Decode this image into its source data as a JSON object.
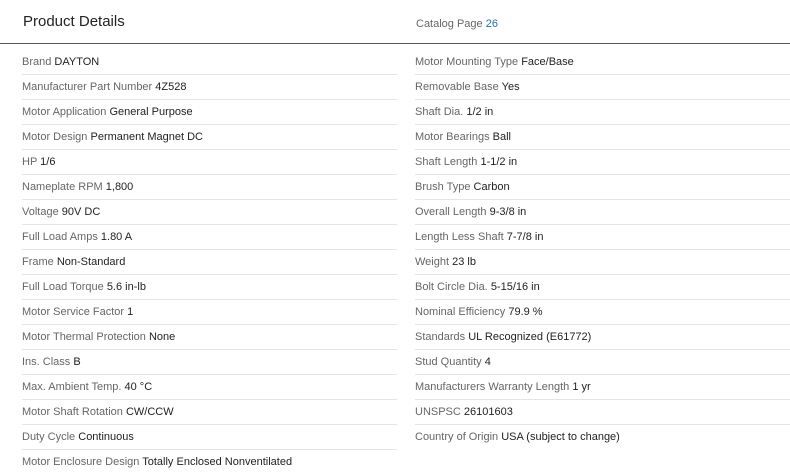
{
  "header": {
    "title": "Product Details",
    "catalog_label": "Catalog Page",
    "catalog_value": "26"
  },
  "left": [
    {
      "label": "Brand",
      "value": "DAYTON"
    },
    {
      "label": "Manufacturer Part Number",
      "value": "4Z528"
    },
    {
      "label": "Motor Application",
      "value": "General Purpose"
    },
    {
      "label": "Motor Design",
      "value": "Permanent Magnet DC"
    },
    {
      "label": "HP",
      "value": "1/6"
    },
    {
      "label": "Nameplate RPM",
      "value": "1,800"
    },
    {
      "label": "Voltage",
      "value": "90V DC"
    },
    {
      "label": "Full Load Amps",
      "value": "1.80 A"
    },
    {
      "label": "Frame",
      "value": "Non-Standard"
    },
    {
      "label": "Full Load Torque",
      "value": "5.6 in-lb"
    },
    {
      "label": "Motor Service Factor",
      "value": "1"
    },
    {
      "label": "Motor Thermal Protection",
      "value": "None"
    },
    {
      "label": "Ins. Class",
      "value": "B"
    },
    {
      "label": "Max. Ambient Temp.",
      "value": "40 °C"
    },
    {
      "label": "Motor Shaft Rotation",
      "value": "CW/CCW"
    },
    {
      "label": "Duty Cycle",
      "value": "Continuous"
    },
    {
      "label": "Motor Enclosure Design",
      "value": "Totally Enclosed Nonventilated"
    }
  ],
  "right": [
    {
      "label": "Motor Mounting Type",
      "value": "Face/Base"
    },
    {
      "label": "Removable Base",
      "value": "Yes"
    },
    {
      "label": "Shaft Dia.",
      "value": "1/2 in"
    },
    {
      "label": "Motor Bearings",
      "value": "Ball"
    },
    {
      "label": "Shaft Length",
      "value": "1-1/2 in"
    },
    {
      "label": "Brush Type",
      "value": "Carbon"
    },
    {
      "label": "Overall Length",
      "value": "9-3/8 in"
    },
    {
      "label": "Length Less Shaft",
      "value": "7-7/8 in"
    },
    {
      "label": "Weight",
      "value": "23 lb"
    },
    {
      "label": "Bolt Circle Dia.",
      "value": "5-15/16 in"
    },
    {
      "label": "Nominal Efficiency",
      "value": "79.9 %"
    },
    {
      "label": "Standards",
      "value": "UL Recognized (E61772)"
    },
    {
      "label": "Stud Quantity",
      "value": "4"
    },
    {
      "label": "Manufacturers Warranty Length",
      "value": "1 yr"
    },
    {
      "label": "UNSPSC",
      "value": "26101603"
    },
    {
      "label": "Country of Origin",
      "value": "USA (subject to change)"
    }
  ]
}
